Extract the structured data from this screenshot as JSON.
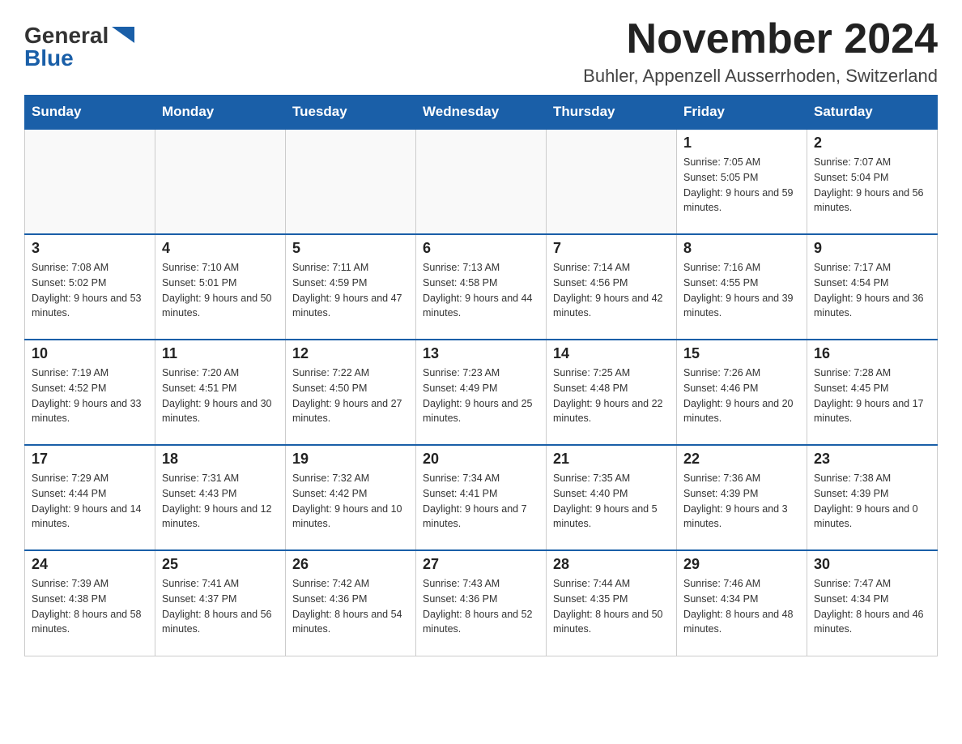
{
  "logo": {
    "general": "General",
    "blue": "Blue"
  },
  "title": "November 2024",
  "location": "Buhler, Appenzell Ausserrhoden, Switzerland",
  "days_of_week": [
    "Sunday",
    "Monday",
    "Tuesday",
    "Wednesday",
    "Thursday",
    "Friday",
    "Saturday"
  ],
  "weeks": [
    [
      {
        "day": "",
        "info": ""
      },
      {
        "day": "",
        "info": ""
      },
      {
        "day": "",
        "info": ""
      },
      {
        "day": "",
        "info": ""
      },
      {
        "day": "",
        "info": ""
      },
      {
        "day": "1",
        "info": "Sunrise: 7:05 AM\nSunset: 5:05 PM\nDaylight: 9 hours and 59 minutes."
      },
      {
        "day": "2",
        "info": "Sunrise: 7:07 AM\nSunset: 5:04 PM\nDaylight: 9 hours and 56 minutes."
      }
    ],
    [
      {
        "day": "3",
        "info": "Sunrise: 7:08 AM\nSunset: 5:02 PM\nDaylight: 9 hours and 53 minutes."
      },
      {
        "day": "4",
        "info": "Sunrise: 7:10 AM\nSunset: 5:01 PM\nDaylight: 9 hours and 50 minutes."
      },
      {
        "day": "5",
        "info": "Sunrise: 7:11 AM\nSunset: 4:59 PM\nDaylight: 9 hours and 47 minutes."
      },
      {
        "day": "6",
        "info": "Sunrise: 7:13 AM\nSunset: 4:58 PM\nDaylight: 9 hours and 44 minutes."
      },
      {
        "day": "7",
        "info": "Sunrise: 7:14 AM\nSunset: 4:56 PM\nDaylight: 9 hours and 42 minutes."
      },
      {
        "day": "8",
        "info": "Sunrise: 7:16 AM\nSunset: 4:55 PM\nDaylight: 9 hours and 39 minutes."
      },
      {
        "day": "9",
        "info": "Sunrise: 7:17 AM\nSunset: 4:54 PM\nDaylight: 9 hours and 36 minutes."
      }
    ],
    [
      {
        "day": "10",
        "info": "Sunrise: 7:19 AM\nSunset: 4:52 PM\nDaylight: 9 hours and 33 minutes."
      },
      {
        "day": "11",
        "info": "Sunrise: 7:20 AM\nSunset: 4:51 PM\nDaylight: 9 hours and 30 minutes."
      },
      {
        "day": "12",
        "info": "Sunrise: 7:22 AM\nSunset: 4:50 PM\nDaylight: 9 hours and 27 minutes."
      },
      {
        "day": "13",
        "info": "Sunrise: 7:23 AM\nSunset: 4:49 PM\nDaylight: 9 hours and 25 minutes."
      },
      {
        "day": "14",
        "info": "Sunrise: 7:25 AM\nSunset: 4:48 PM\nDaylight: 9 hours and 22 minutes."
      },
      {
        "day": "15",
        "info": "Sunrise: 7:26 AM\nSunset: 4:46 PM\nDaylight: 9 hours and 20 minutes."
      },
      {
        "day": "16",
        "info": "Sunrise: 7:28 AM\nSunset: 4:45 PM\nDaylight: 9 hours and 17 minutes."
      }
    ],
    [
      {
        "day": "17",
        "info": "Sunrise: 7:29 AM\nSunset: 4:44 PM\nDaylight: 9 hours and 14 minutes."
      },
      {
        "day": "18",
        "info": "Sunrise: 7:31 AM\nSunset: 4:43 PM\nDaylight: 9 hours and 12 minutes."
      },
      {
        "day": "19",
        "info": "Sunrise: 7:32 AM\nSunset: 4:42 PM\nDaylight: 9 hours and 10 minutes."
      },
      {
        "day": "20",
        "info": "Sunrise: 7:34 AM\nSunset: 4:41 PM\nDaylight: 9 hours and 7 minutes."
      },
      {
        "day": "21",
        "info": "Sunrise: 7:35 AM\nSunset: 4:40 PM\nDaylight: 9 hours and 5 minutes."
      },
      {
        "day": "22",
        "info": "Sunrise: 7:36 AM\nSunset: 4:39 PM\nDaylight: 9 hours and 3 minutes."
      },
      {
        "day": "23",
        "info": "Sunrise: 7:38 AM\nSunset: 4:39 PM\nDaylight: 9 hours and 0 minutes."
      }
    ],
    [
      {
        "day": "24",
        "info": "Sunrise: 7:39 AM\nSunset: 4:38 PM\nDaylight: 8 hours and 58 minutes."
      },
      {
        "day": "25",
        "info": "Sunrise: 7:41 AM\nSunset: 4:37 PM\nDaylight: 8 hours and 56 minutes."
      },
      {
        "day": "26",
        "info": "Sunrise: 7:42 AM\nSunset: 4:36 PM\nDaylight: 8 hours and 54 minutes."
      },
      {
        "day": "27",
        "info": "Sunrise: 7:43 AM\nSunset: 4:36 PM\nDaylight: 8 hours and 52 minutes."
      },
      {
        "day": "28",
        "info": "Sunrise: 7:44 AM\nSunset: 4:35 PM\nDaylight: 8 hours and 50 minutes."
      },
      {
        "day": "29",
        "info": "Sunrise: 7:46 AM\nSunset: 4:34 PM\nDaylight: 8 hours and 48 minutes."
      },
      {
        "day": "30",
        "info": "Sunrise: 7:47 AM\nSunset: 4:34 PM\nDaylight: 8 hours and 46 minutes."
      }
    ]
  ]
}
